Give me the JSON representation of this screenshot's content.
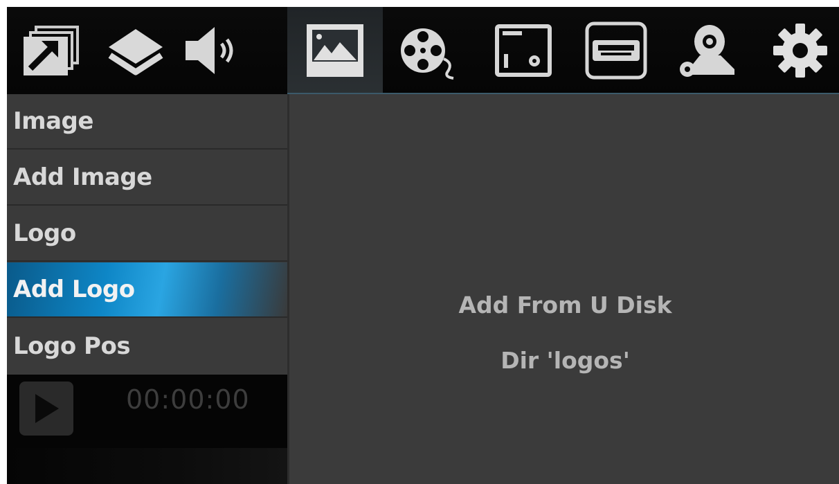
{
  "toolbar": {
    "icons": [
      {
        "name": "export-icon"
      },
      {
        "name": "layers-icon"
      },
      {
        "name": "speaker-icon"
      },
      {
        "name": "image-icon",
        "active": true
      },
      {
        "name": "film-reel-icon"
      },
      {
        "name": "window-settings-icon"
      },
      {
        "name": "hdmi-icon"
      },
      {
        "name": "camera-settings-icon"
      },
      {
        "name": "gear-icon"
      }
    ]
  },
  "menu": {
    "items": [
      {
        "label": "Image"
      },
      {
        "label": "Add Image"
      },
      {
        "label": "Logo"
      },
      {
        "label": "Add Logo",
        "selected": true
      },
      {
        "label": "Logo Pos"
      }
    ]
  },
  "player": {
    "timecode": "00:00:00"
  },
  "main": {
    "line1": "Add From U Disk",
    "line2": "Dir 'logos'"
  },
  "colors": {
    "accent": "#0e86c6",
    "panel": "#3b3b3b",
    "menu_bg": "#3a3a3a",
    "text": "#d8d8d8"
  }
}
